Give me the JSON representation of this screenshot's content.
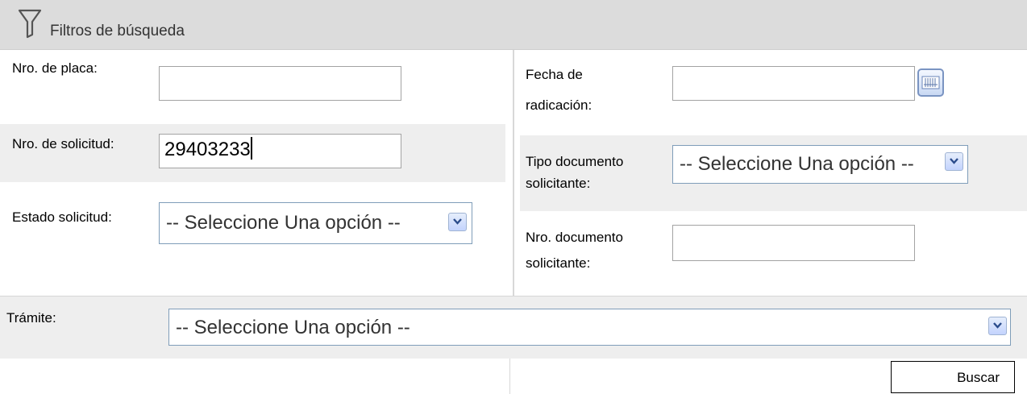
{
  "header": {
    "title": "Filtros de búsqueda",
    "icon": "filter-icon"
  },
  "left": {
    "plate_label": "Nro. de placa:",
    "plate_value": "",
    "request_label": "Nro. de solicitud:",
    "request_value": "29403233",
    "status_label": "Estado solicitud:",
    "status_selected": "-- Seleccione Una opción --"
  },
  "right": {
    "date_label_1": "Fecha de",
    "date_label_2": "radicación:",
    "date_value": "",
    "doctype_label_1": "Tipo documento",
    "doctype_label_2": "solicitante:",
    "doctype_selected": "-- Seleccione Una opción --",
    "docnum_label_1": "Nro. documento",
    "docnum_label_2": "solicitante:",
    "docnum_value": ""
  },
  "tramite": {
    "label": "Trámite:",
    "selected": "-- Seleccione Una opción --"
  },
  "actions": {
    "search_label": "Buscar"
  }
}
